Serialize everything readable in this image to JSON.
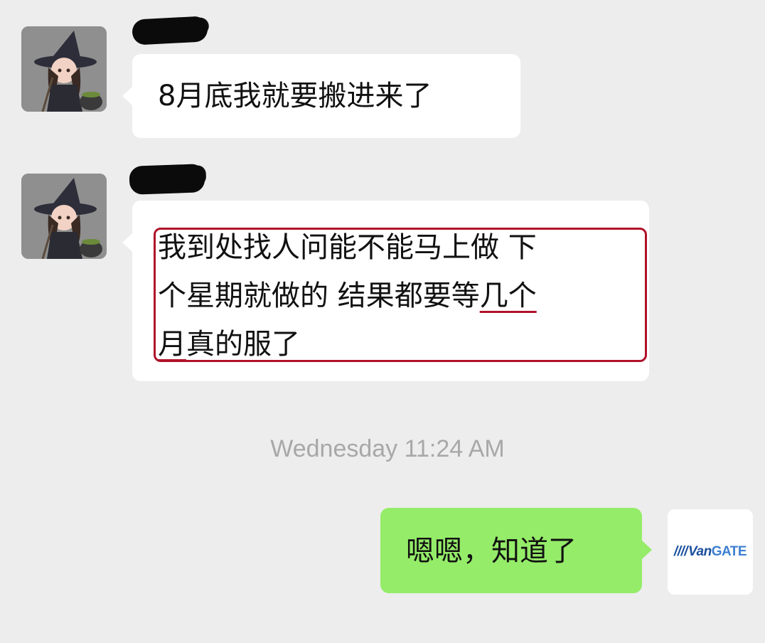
{
  "messages": [
    {
      "side": "received",
      "avatar": "witch-avatar",
      "text": "8月底我就要搬进来了"
    },
    {
      "side": "received",
      "avatar": "witch-avatar",
      "lines": [
        "我到处找人问能不能马上做 下",
        "个星期就做的 结果都要等",
        "几个",
        "月",
        "真的服了"
      ],
      "highlighted": true,
      "underlined_text": "几个月"
    },
    {
      "side": "sent",
      "avatar": "vangate-logo",
      "text": "嗯嗯，知道了"
    }
  ],
  "timestamp": "Wednesday 11:24 AM",
  "self_avatar": {
    "logo_stripes": "////",
    "logo_van": "Van",
    "logo_gate": "GATE"
  },
  "colors": {
    "background": "#ededed",
    "received_bubble": "#ffffff",
    "sent_bubble": "#95ec69",
    "highlight": "#b0122a",
    "timestamp": "#a8a8a8"
  }
}
